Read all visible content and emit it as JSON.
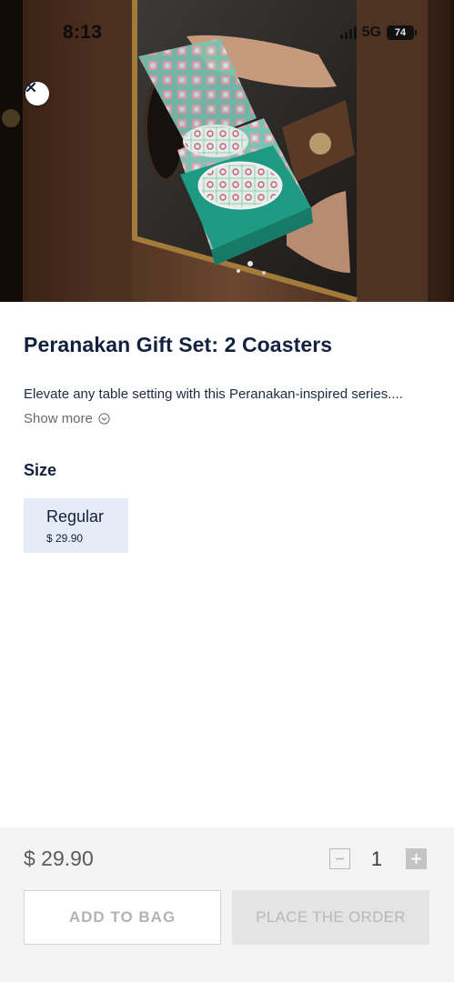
{
  "status_bar": {
    "time": "8:13",
    "network": "5G",
    "battery": "74"
  },
  "hero": {
    "image_description_icon": "product-photo",
    "close_icon": "close-icon"
  },
  "product": {
    "title": "Peranakan Gift Set: 2 Coasters",
    "description": "Elevate any table setting with this Peranakan-inspired series....",
    "show_more_label": "Show more"
  },
  "size": {
    "heading": "Size",
    "options": [
      {
        "name": "Regular",
        "price": "$ 29.90",
        "selected": true
      }
    ]
  },
  "cart_bar": {
    "total_price": "$ 29.90",
    "quantity": "1",
    "add_to_bag_label": "ADD TO BAG",
    "place_order_label": "PLACE THE ORDER"
  },
  "colors": {
    "title": "#13213f",
    "size_selected_bg": "#e6ecf7",
    "box_teal": "#1f9a82",
    "bottom_bar_bg": "#f4f4f4"
  }
}
